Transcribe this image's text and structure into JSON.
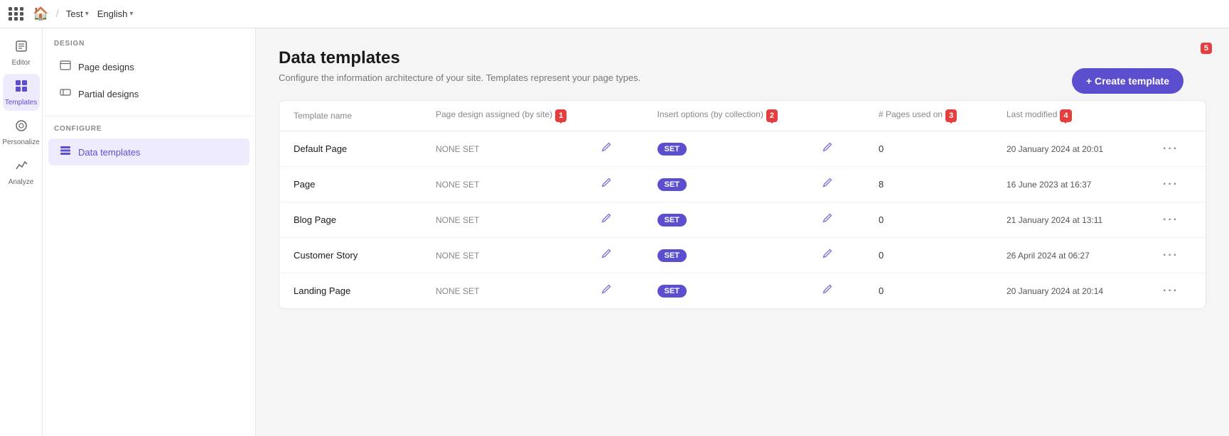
{
  "topnav": {
    "site_label": "Test",
    "lang_label": "English"
  },
  "sidebar": {
    "items": [
      {
        "id": "editor",
        "label": "Editor",
        "icon": "📄",
        "active": false
      },
      {
        "id": "templates",
        "label": "Templates",
        "icon": "⊞",
        "active": true
      },
      {
        "id": "personalize",
        "label": "Personalize",
        "icon": "◎",
        "active": false
      },
      {
        "id": "analyze",
        "label": "Analyze",
        "icon": "📈",
        "active": false
      }
    ]
  },
  "left_panel": {
    "design_section": "DESIGN",
    "configure_section": "CONFIGURE",
    "design_items": [
      {
        "id": "page-designs",
        "label": "Page designs",
        "icon": "▭"
      },
      {
        "id": "partial-designs",
        "label": "Partial designs",
        "icon": "▬"
      }
    ],
    "configure_items": [
      {
        "id": "data-templates",
        "label": "Data templates",
        "icon": "≡",
        "active": true
      }
    ]
  },
  "main": {
    "title": "Data templates",
    "subtitle": "Configure the information architecture of your site. Templates represent your page types.",
    "create_button": "+ Create template",
    "table": {
      "headers": [
        {
          "id": "name",
          "label": "Template name"
        },
        {
          "id": "page-design",
          "label": "Page design assigned (by site)",
          "badge": "1"
        },
        {
          "id": "insert-options",
          "label": "Insert options (by collection)",
          "badge": "2"
        },
        {
          "id": "pages-used",
          "label": "# Pages used on",
          "badge": "3"
        },
        {
          "id": "last-modified",
          "label": "Last modified",
          "badge": "4"
        }
      ],
      "rows": [
        {
          "name": "Default Page",
          "page_design": "NONE SET",
          "insert_options": "SET",
          "pages_used": "0",
          "last_modified": "20 January 2024 at 20:01"
        },
        {
          "name": "Page",
          "page_design": "NONE SET",
          "insert_options": "SET",
          "pages_used": "8",
          "last_modified": "16 June 2023 at 16:37"
        },
        {
          "name": "Blog Page",
          "page_design": "NONE SET",
          "insert_options": "SET",
          "pages_used": "0",
          "last_modified": "21 January 2024 at 13:11"
        },
        {
          "name": "Customer Story",
          "page_design": "NONE SET",
          "insert_options": "SET",
          "pages_used": "0",
          "last_modified": "26 April 2024 at 06:27"
        },
        {
          "name": "Landing Page",
          "page_design": "NONE SET",
          "insert_options": "SET",
          "pages_used": "0",
          "last_modified": "20 January 2024 at 20:14"
        }
      ]
    }
  },
  "annotation_badges": {
    "badge5": "5"
  }
}
